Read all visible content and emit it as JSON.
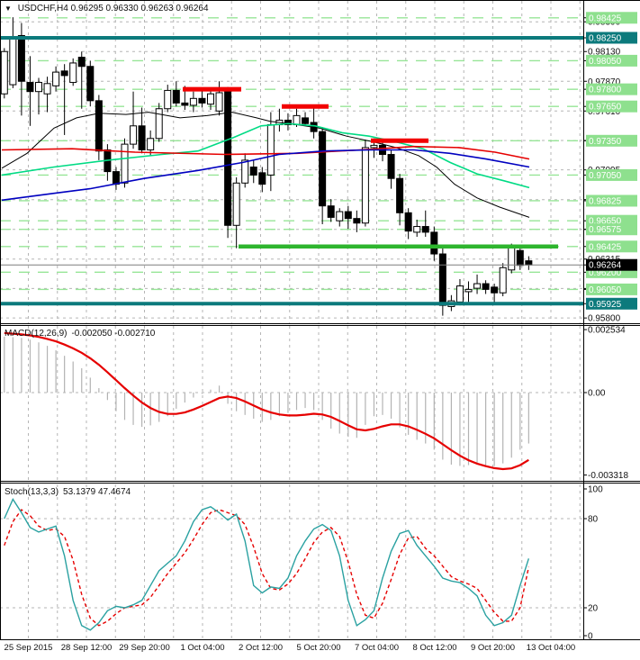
{
  "window": {
    "title": "USDCHF,H4",
    "ohlc": "0.96295 0.96330 0.96263 0.96264"
  },
  "colors": {
    "grid": "#b6b6b6",
    "level_green_dash": "#97e597",
    "badge_green": "#8ee08e",
    "badge_teal": "#0c7a7c",
    "badge_black": "#000000",
    "teal_line": "#0c7a7c",
    "support_green": "#2eb52e",
    "resistance_red": "#f20000",
    "bid_line": "#7d7d7d",
    "candle_up": "#ffffff",
    "candle_down": "#000000",
    "macd_hist": "#b3b3b3",
    "macd_signal": "#e60000",
    "stoch_k": "#2aa1a1",
    "stoch_d": "#e60000"
  },
  "chart_data": [
    {
      "type": "candlestick",
      "symbol": "USDCHF",
      "timeframe": "H4",
      "display_ohlc": {
        "open": "0.96295",
        "high": "0.96330",
        "low": "0.96263",
        "close": "0.96264"
      },
      "x_labels": [
        "25 Sep 2015",
        "28 Sep 12:00",
        "29 Sep 20:00",
        "1 Oct 04:00",
        "2 Oct 12:00",
        "5 Oct 20:00",
        "7 Oct 04:00",
        "8 Oct 12:00",
        "9 Oct 20:00",
        "13 Oct 04:00"
      ],
      "y_range": {
        "top": 0.98585,
        "bottom": 0.95755
      },
      "grid_prices": [
        0.9839,
        0.9813,
        0.9787,
        0.9761,
        0.97352,
        0.97095,
        0.96835,
        0.96575,
        0.96315,
        0.96058,
        0.958
      ],
      "green_levels": [
        0.98425,
        0.9805,
        0.978,
        0.9765,
        0.9735,
        0.9705,
        0.96825,
        0.9665,
        0.96575,
        0.96425,
        0.962,
        0.9605
      ],
      "teal_lines": [
        0.9825,
        0.95925
      ],
      "support_line": {
        "price": 0.96425,
        "x1": 265,
        "x2": 620
      },
      "resistance_segments": [
        {
          "price": 0.978,
          "x1": 203,
          "x2": 268
        },
        {
          "price": 0.9765,
          "x1": 313,
          "x2": 365
        },
        {
          "price": 0.9735,
          "x1": 412,
          "x2": 476
        }
      ],
      "bid": 0.96264,
      "candles": [
        [
          0.9776,
          0.9816,
          0.9772,
          0.9813
        ],
        [
          0.9784,
          0.9843,
          0.9781,
          0.9826
        ],
        [
          0.9827,
          0.9838,
          0.9757,
          0.9787
        ],
        [
          0.9786,
          0.9809,
          0.9748,
          0.9778
        ],
        [
          0.9778,
          0.979,
          0.9758,
          0.9786
        ],
        [
          0.9776,
          0.9791,
          0.976,
          0.9785
        ],
        [
          0.9783,
          0.98,
          0.9778,
          0.9795
        ],
        [
          0.9796,
          0.9802,
          0.974,
          0.9792
        ],
        [
          0.9786,
          0.9807,
          0.9783,
          0.9803
        ],
        [
          0.9808,
          0.9813,
          0.9763,
          0.98
        ],
        [
          0.98,
          0.9805,
          0.9765,
          0.977
        ],
        [
          0.977,
          0.9775,
          0.9718,
          0.9726
        ],
        [
          0.9727,
          0.9732,
          0.97,
          0.9708
        ],
        [
          0.9708,
          0.9712,
          0.9692,
          0.9697
        ],
        [
          0.9698,
          0.9737,
          0.9694,
          0.9732
        ],
        [
          0.9732,
          0.9778,
          0.9728,
          0.9748
        ],
        [
          0.9748,
          0.9764,
          0.9724,
          0.9727
        ],
        [
          0.9727,
          0.9744,
          0.9722,
          0.9737
        ],
        [
          0.9737,
          0.9768,
          0.9734,
          0.9763
        ],
        [
          0.9763,
          0.9784,
          0.976,
          0.9779
        ],
        [
          0.9779,
          0.9787,
          0.9765,
          0.9768
        ],
        [
          0.9768,
          0.9783,
          0.9762,
          0.9766
        ],
        [
          0.9766,
          0.9778,
          0.976,
          0.9772
        ],
        [
          0.9772,
          0.9781,
          0.9764,
          0.9768
        ],
        [
          0.9767,
          0.978,
          0.9762,
          0.9776
        ],
        [
          0.9761,
          0.9787,
          0.9757,
          0.9777
        ],
        [
          0.9778,
          0.9782,
          0.965,
          0.9661
        ],
        [
          0.9661,
          0.9703,
          0.9641,
          0.9698
        ],
        [
          0.9698,
          0.9724,
          0.9694,
          0.9718
        ],
        [
          0.9712,
          0.9718,
          0.9698,
          0.9705
        ],
        [
          0.9707,
          0.9712,
          0.969,
          0.9697
        ],
        [
          0.9705,
          0.976,
          0.9691,
          0.9749
        ],
        [
          0.9749,
          0.9763,
          0.9743,
          0.9753
        ],
        [
          0.9753,
          0.9759,
          0.9744,
          0.9749
        ],
        [
          0.9749,
          0.9763,
          0.9747,
          0.9757
        ],
        [
          0.9755,
          0.976,
          0.9748,
          0.975
        ],
        [
          0.9751,
          0.9764,
          0.9737,
          0.9743
        ],
        [
          0.9743,
          0.9747,
          0.9662,
          0.9678
        ],
        [
          0.9678,
          0.9684,
          0.9664,
          0.9668
        ],
        [
          0.9665,
          0.9676,
          0.966,
          0.9673
        ],
        [
          0.9673,
          0.9678,
          0.9658,
          0.9667
        ],
        [
          0.9667,
          0.9674,
          0.9655,
          0.9663
        ],
        [
          0.9663,
          0.9736,
          0.966,
          0.9729
        ],
        [
          0.9729,
          0.9737,
          0.972,
          0.9731
        ],
        [
          0.9731,
          0.9734,
          0.9717,
          0.9723
        ],
        [
          0.9723,
          0.9727,
          0.9693,
          0.9702
        ],
        [
          0.9702,
          0.9706,
          0.9661,
          0.9672
        ],
        [
          0.9672,
          0.9676,
          0.9649,
          0.9656
        ],
        [
          0.9655,
          0.9666,
          0.9651,
          0.966
        ],
        [
          0.966,
          0.9674,
          0.9651,
          0.9655
        ],
        [
          0.9655,
          0.966,
          0.963,
          0.9636
        ],
        [
          0.9636,
          0.9641,
          0.9582,
          0.9591
        ],
        [
          0.959,
          0.96,
          0.9586,
          0.9595
        ],
        [
          0.9594,
          0.9614,
          0.9591,
          0.9608
        ],
        [
          0.9603,
          0.9612,
          0.9594,
          0.9605
        ],
        [
          0.9606,
          0.9618,
          0.9601,
          0.961
        ],
        [
          0.961,
          0.9613,
          0.9601,
          0.9605
        ],
        [
          0.9607,
          0.961,
          0.9592,
          0.9602
        ],
        [
          0.9602,
          0.9628,
          0.9599,
          0.9624
        ],
        [
          0.9622,
          0.9645,
          0.9619,
          0.9642
        ],
        [
          0.9639,
          0.9644,
          0.9622,
          0.9626
        ],
        [
          0.963,
          0.9634,
          0.9622,
          0.96264
        ]
      ],
      "ma": [
        {
          "name": "ma-black",
          "color": "#000000",
          "width": 1,
          "points": [
            [
              2,
              0.9711
            ],
            [
              30,
              0.9724
            ],
            [
              60,
              0.9746
            ],
            [
              85,
              0.9755
            ],
            [
              110,
              0.9759
            ],
            [
              140,
              0.9758
            ],
            [
              165,
              0.976
            ],
            [
              200,
              0.9755
            ],
            [
              230,
              0.9757
            ],
            [
              258,
              0.976
            ],
            [
              285,
              0.9755
            ],
            [
              300,
              0.9752
            ],
            [
              330,
              0.9749
            ],
            [
              355,
              0.9746
            ],
            [
              385,
              0.9739
            ],
            [
              415,
              0.9734
            ],
            [
              440,
              0.9729
            ],
            [
              465,
              0.9722
            ],
            [
              485,
              0.9712
            ],
            [
              505,
              0.9697
            ],
            [
              530,
              0.9685
            ],
            [
              555,
              0.9677
            ],
            [
              588,
              0.9668
            ]
          ]
        },
        {
          "name": "ma-green",
          "color": "#00db84",
          "width": 1.6,
          "points": [
            [
              2,
              0.9705
            ],
            [
              60,
              0.9712
            ],
            [
              120,
              0.9718
            ],
            [
              180,
              0.9723
            ],
            [
              220,
              0.9726
            ],
            [
              260,
              0.9738
            ],
            [
              290,
              0.9748
            ],
            [
              320,
              0.975
            ],
            [
              350,
              0.9748
            ],
            [
              380,
              0.9742
            ],
            [
              410,
              0.9739
            ],
            [
              440,
              0.9734
            ],
            [
              470,
              0.9728
            ],
            [
              500,
              0.9716
            ],
            [
              530,
              0.9706
            ],
            [
              560,
              0.97
            ],
            [
              588,
              0.9694
            ]
          ]
        },
        {
          "name": "ma-red",
          "color": "#e60000",
          "width": 1.6,
          "points": [
            [
              2,
              0.9727
            ],
            [
              80,
              0.9728
            ],
            [
              150,
              0.9725
            ],
            [
              250,
              0.9723
            ],
            [
              330,
              0.9724
            ],
            [
              400,
              0.9727
            ],
            [
              460,
              0.973
            ],
            [
              510,
              0.9729
            ],
            [
              550,
              0.9725
            ],
            [
              588,
              0.9719
            ]
          ]
        },
        {
          "name": "ma-blue",
          "color": "#0000c0",
          "width": 1.6,
          "points": [
            [
              2,
              0.9683
            ],
            [
              60,
              0.9689
            ],
            [
              100,
              0.9693
            ],
            [
              160,
              0.9702
            ],
            [
              220,
              0.9709
            ],
            [
              270,
              0.9716
            ],
            [
              310,
              0.9723
            ],
            [
              360,
              0.9726
            ],
            [
              410,
              0.9727
            ],
            [
              460,
              0.9727
            ],
            [
              500,
              0.9724
            ],
            [
              540,
              0.9719
            ],
            [
              588,
              0.9712
            ]
          ]
        }
      ]
    },
    {
      "type": "macd-histogram",
      "label": "MACD(12,26,9)",
      "display_values": "-0.002050 -0.002710",
      "axis": {
        "top_label": "0.002534",
        "zero_label": "0.00",
        "bottom_label": "-0.003318",
        "top": 0.002534,
        "bottom": -0.003318
      },
      "histogram": [
        0.00225,
        0.00223,
        0.0022,
        0.00213,
        0.00202,
        0.00188,
        0.0017,
        0.00148,
        0.00125,
        0.00098,
        0.0006,
        0.00018,
        -0.0003,
        -0.00075,
        -0.0011,
        -0.0013,
        -0.00138,
        -0.00132,
        -0.00118,
        -0.00095,
        -0.00065,
        -0.0004,
        -0.0002,
        -5e-05,
        0.00012,
        0.00028,
        -0.00045,
        -0.00075,
        -0.0009,
        -0.00105,
        -0.00118,
        -0.0011,
        -0.00095,
        -0.00082,
        -0.0007,
        -0.00062,
        -0.0007,
        -0.0011,
        -0.00145,
        -0.00165,
        -0.00178,
        -0.00182,
        -0.0013,
        -0.00095,
        -0.0009,
        -0.00105,
        -0.0014,
        -0.0017,
        -0.0019,
        -0.00205,
        -0.0023,
        -0.0027,
        -0.0029,
        -0.00295,
        -0.00292,
        -0.0029,
        -0.00292,
        -0.00296,
        -0.00285,
        -0.00262,
        -0.0023,
        -0.00205
      ],
      "signal": [
        0.0024,
        0.00237,
        0.00234,
        0.0023,
        0.00224,
        0.00216,
        0.00206,
        0.00193,
        0.00178,
        0.0016,
        0.00138,
        0.00112,
        0.00082,
        0.0005,
        0.00018,
        -0.00012,
        -0.0004,
        -0.00062,
        -0.00078,
        -0.00086,
        -0.00086,
        -0.0008,
        -0.00068,
        -0.00054,
        -0.00038,
        -0.00022,
        -0.00016,
        -0.00022,
        -0.00036,
        -0.00052,
        -0.00068,
        -0.0008,
        -0.00088,
        -0.00092,
        -0.00092,
        -0.00089,
        -0.00085,
        -0.00088,
        -0.00098,
        -0.00114,
        -0.00132,
        -0.00148,
        -0.00152,
        -0.00146,
        -0.00136,
        -0.00128,
        -0.00128,
        -0.00136,
        -0.0015,
        -0.00166,
        -0.00184,
        -0.00208,
        -0.00232,
        -0.00254,
        -0.00272,
        -0.00286,
        -0.00296,
        -0.00304,
        -0.00308,
        -0.00305,
        -0.00292,
        -0.00271
      ]
    },
    {
      "type": "stochastic",
      "label": "Stoch(13,3,3)",
      "display_values": "53.1379 47.4674",
      "axis_labels": [
        "100",
        "80",
        "20",
        "0"
      ],
      "grid": [
        80,
        20
      ],
      "range": [
        0,
        100
      ],
      "k": [
        80,
        93,
        84,
        74,
        71,
        73,
        75,
        55,
        25,
        8,
        5,
        10,
        18,
        21,
        20,
        22,
        25,
        35,
        45,
        50,
        55,
        65,
        78,
        86,
        88,
        84,
        79,
        83,
        65,
        35,
        30,
        34,
        33,
        40,
        55,
        65,
        73,
        76,
        72,
        55,
        25,
        8,
        12,
        18,
        40,
        58,
        70,
        72,
        62,
        55,
        48,
        40,
        38,
        37,
        33,
        28,
        15,
        8,
        10,
        15,
        35,
        53.14
      ],
      "d": [
        62,
        78,
        86,
        82,
        75,
        72,
        73,
        68,
        52,
        29,
        13,
        8,
        11,
        16,
        20,
        21,
        22,
        27,
        35,
        43,
        50,
        57,
        66,
        76,
        84,
        86,
        84,
        82,
        76,
        61,
        43,
        33,
        32,
        36,
        43,
        53,
        64,
        71,
        74,
        68,
        51,
        29,
        15,
        13,
        23,
        39,
        56,
        67,
        68,
        60,
        55,
        48,
        41,
        38,
        36,
        33,
        25,
        17,
        11,
        11,
        20,
        47.47
      ]
    }
  ]
}
